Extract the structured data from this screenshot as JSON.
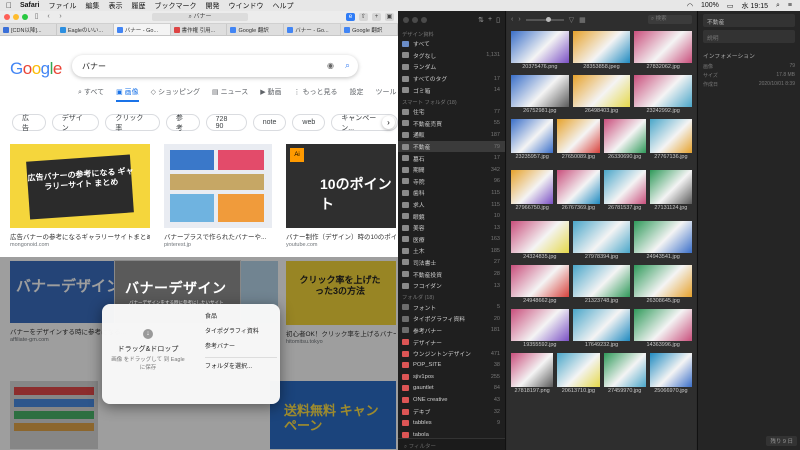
{
  "menubar": {
    "app": "Safari",
    "items": [
      "ファイル",
      "編集",
      "表示",
      "履歴",
      "ブックマーク",
      "開発",
      "ウインドウ",
      "ヘルプ"
    ],
    "battery": "100%",
    "clock": "水 19:15"
  },
  "safari": {
    "url": "バナー",
    "tabs": [
      {
        "label": "[CDN以降]...",
        "color": "#3a6fd8"
      },
      {
        "label": "Eagleのいい...",
        "color": "#2c8fe0"
      },
      {
        "label": "バナー - Go...",
        "color": "#4285f4"
      },
      {
        "label": "書作権 引用...",
        "color": "#d44"
      },
      {
        "label": "Google 翻訳",
        "color": "#4285f4"
      },
      {
        "label": "バナー - Go...",
        "color": "#4285f4"
      },
      {
        "label": "Google 翻訳",
        "color": "#4285f4"
      }
    ],
    "google": {
      "logo": [
        "G",
        "o",
        "o",
        "g",
        "l",
        "e"
      ],
      "query": "バナー",
      "nav": [
        "すべて",
        "画像",
        "ショッピング",
        "ニュース",
        "動画",
        "もっと見る",
        "設定",
        "ツール"
      ],
      "chips": [
        "広告",
        "デザイン",
        "クリック率",
        "参考",
        "728 90",
        "note",
        "web",
        "キャンペーン..."
      ]
    },
    "results": [
      {
        "title": "広告バナーの参考になるギャラリーサイトまとめ...",
        "source": "mongonoid.com",
        "art_text": "広告バナーの参考になる ギャラリーサイト まとめ"
      },
      {
        "title": "バナープラスで作られたバナーや...",
        "source": "pinterest.jp",
        "art_text": ""
      },
      {
        "title": "バナー制作（デザイン）時の10のポイント...",
        "source": "youtube.com",
        "art_text": "10のポイント"
      },
      {
        "title": "バナーをデザインする時に参考になる...",
        "source": "affiliate-gm.com",
        "art_text": "バナーデザイン"
      },
      {
        "title": "",
        "source": "",
        "art_text": ""
      },
      {
        "title": "初心者OK！クリック率を上げるバナー...",
        "source": "hitomitsu.tokyo",
        "art_text": "クリック率を上げたった3の方法"
      },
      {
        "title": "",
        "source": "",
        "art_text": ""
      },
      {
        "title": "",
        "source": "",
        "art_text": "送料無料 キャンペーン"
      }
    ],
    "drag_ghost": {
      "title": "バナーデザイン",
      "subtitle": "バナーデザインをする時に参考にしたいサイト"
    },
    "drop_popup": {
      "title": "ドラッグ&ドロップ",
      "desc": "画像 をドラッグして 到 Eagle に保存",
      "menu": [
        "食品",
        "タイポグラフィ資料",
        "参考バナー",
        "フォルダを選択..."
      ]
    }
  },
  "eagle": {
    "sidebar": {
      "library": "デザイン資料",
      "top": [
        {
          "label": "すべて",
          "count": "",
          "color": "#6a8cc7"
        },
        {
          "label": "タグなし",
          "count": "1,131",
          "color": "#8b8b8b"
        },
        {
          "label": "ランダム",
          "count": "",
          "color": "#8b8b8b"
        },
        {
          "label": "すべてのタグ",
          "count": "17",
          "color": "#8b8b8b"
        },
        {
          "label": "ゴミ箱",
          "count": "14",
          "color": "#8b8b8b"
        }
      ],
      "smart_head": "スマート フォルダ (18)",
      "smart": [
        {
          "label": "住宅",
          "count": "77"
        },
        {
          "label": "不動産売買",
          "count": "55"
        },
        {
          "label": "通販",
          "count": "187"
        },
        {
          "label": "不動産",
          "count": "79"
        },
        {
          "label": "墓石",
          "count": "17"
        },
        {
          "label": "期間",
          "count": "342"
        },
        {
          "label": "寺院",
          "count": "96"
        },
        {
          "label": "歯科",
          "count": "115"
        },
        {
          "label": "求人",
          "count": "115"
        },
        {
          "label": "眼鏡",
          "count": "10"
        },
        {
          "label": "美容",
          "count": "13"
        },
        {
          "label": "医療",
          "count": "163"
        },
        {
          "label": "土木",
          "count": "185"
        },
        {
          "label": "司法書士",
          "count": "27"
        },
        {
          "label": "不動産投資",
          "count": "28"
        },
        {
          "label": "フコイダン",
          "count": "13"
        }
      ],
      "folder_head": "フォルダ (18)",
      "folders": [
        {
          "label": "フォント",
          "count": "5",
          "color": "#6c6c6c"
        },
        {
          "label": "タイポグラフィ資料",
          "count": "20",
          "color": "#6c6c6c"
        },
        {
          "label": "参考バナー",
          "count": "181",
          "color": "#6c6c6c"
        },
        {
          "label": "デザイナー",
          "count": "",
          "color": "#d55"
        },
        {
          "label": "ウンジントンデザイン",
          "count": "471",
          "color": "#d55"
        },
        {
          "label": "POP_SITE",
          "count": "38",
          "color": "#d55"
        },
        {
          "label": "sjiv1pos",
          "count": "255",
          "color": "#d55"
        },
        {
          "label": "gauntlet",
          "count": "84",
          "color": "#d55"
        },
        {
          "label": "ONE creative",
          "count": "43",
          "color": "#d55"
        },
        {
          "label": "デキブ",
          "count": "32",
          "color": "#d55"
        },
        {
          "label": "tabbles",
          "count": "9",
          "color": "#d55"
        },
        {
          "label": "tabola",
          "count": "",
          "color": "#d55"
        }
      ],
      "search_placeholder": "フィルター"
    },
    "search_placeholder": "検索",
    "grid": [
      "20375476.png",
      "28353858.jpeg",
      "27832062.jpg",
      "26752981.jpg",
      "26498403.jpg",
      "23242992.jpg",
      "23235957.jpg",
      "27650089.jpg",
      "26330690.jpg",
      "27767136.jpg",
      "27966750.jpg",
      "26767369.jpg",
      "26781537.jpg",
      "27131124.jpg",
      "24324835.jpg",
      "27978394.jpg",
      "24943541.jpg",
      "24948662.jpg",
      "21323748.jpg",
      "26308645.jpg",
      "19355592.jpg",
      "17649232.jpg",
      "14363996.jpg",
      "27818197.png",
      "20613710.jpg",
      "27459970.jpg",
      "25066970.jpg"
    ],
    "inspector": {
      "title": "不動産",
      "note_placeholder": "説明",
      "info_head": "インフォメーション",
      "rows": [
        {
          "k": "画像",
          "v": "79"
        },
        {
          "k": "サイズ",
          "v": "17.8 MB"
        },
        {
          "k": "作成日",
          "v": "2020/10/01 8:39"
        }
      ],
      "status": "残り 9 日"
    }
  }
}
